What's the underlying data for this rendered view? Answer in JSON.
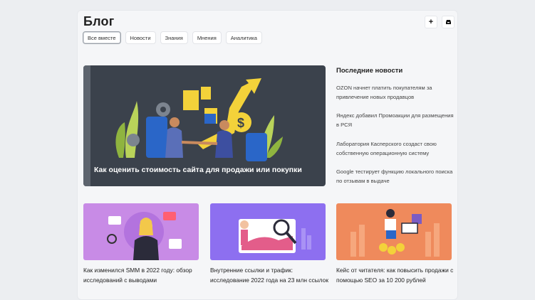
{
  "page": {
    "title": "Блог"
  },
  "tabs": [
    {
      "label": "Все вместе",
      "active": true
    },
    {
      "label": "Новости"
    },
    {
      "label": "Знания"
    },
    {
      "label": "Мнения"
    },
    {
      "label": "Аналитика"
    }
  ],
  "actions": {
    "add_icon": "+",
    "inbox_icon": "inbox-icon"
  },
  "hero": {
    "title": "Как оценить стоимость сайта для продажи или покупки"
  },
  "sidebar": {
    "title": "Последние новости",
    "items": [
      {
        "line1": "OZON начнет платить покупателям за",
        "line2": "привлечение новых продавцов"
      },
      {
        "line1": "Яндекс добавил Промоакции для размещения",
        "line2": "в РСЯ"
      },
      {
        "line1": "Лаборатория Касперского создаст свою",
        "line2": "собственную операционную систему"
      },
      {
        "line1": "Google тестирует функцию локального поиска",
        "line2": "по отзывам в выдаче"
      }
    ]
  },
  "cards": [
    {
      "line1": "Как изменился SMM в 2022 году: обзор",
      "line2": "исследований с выводами",
      "color": "#c88be6"
    },
    {
      "line1": "Внутренние ссылки и трафик:",
      "line2": "исследование 2022 года на 23 млн ссылок",
      "color": "#8d6ff0"
    },
    {
      "line1": "Кейс от читателя: как повысить продажи с",
      "line2": "помощью SEO за 10 200 рублей",
      "color": "#ef8a5c"
    }
  ],
  "colors": {
    "accent_yellow": "#f3d23a",
    "hero_bg": "#3b424c"
  }
}
